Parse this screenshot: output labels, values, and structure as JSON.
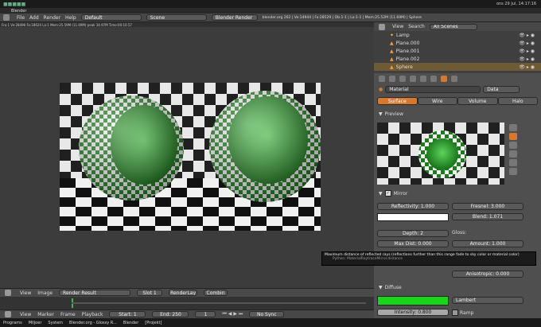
{
  "system_top": {
    "tray_text": "ons 29 Jul, 14:17:16"
  },
  "window_title": "Blender",
  "infobar": {
    "menus": [
      "File",
      "Add",
      "Render",
      "Help"
    ],
    "layout": "Default",
    "scene": "Scene",
    "engine": "Blender Render",
    "stats": "blender.org 262 | Ve:14944 | Fa:28529 | Ob:1-1 | La:1-1 | Mem:25.52M (11.69M) | Sphere"
  },
  "render_stats": "Fra:1  Ve:28496 Fa:18624 La:1 Mem:25.59M (11.69M) peak 34.97M Time:00:10.57",
  "outliner": {
    "view": "View",
    "search": "Search",
    "filter": "All Scenes",
    "items": [
      "Lamp",
      "Plane.000",
      "Plane.001",
      "Plane.002",
      "Sphere"
    ]
  },
  "properties": {
    "material_name": "Material",
    "data_label": "Data",
    "tabs": [
      "Surface",
      "Wire",
      "Volume",
      "Halo"
    ],
    "preview_label": "Preview",
    "mirror_label": "Mirror",
    "reflectivity": "Reflectivity: 1.000",
    "fresnel": "Fresnel: 3.000",
    "blend": "Blend: 1.071",
    "depth": "Depth: 2",
    "gloss_label": "Gloss:",
    "max_dist": "Max Dist: 0.000",
    "amount": "Amount: 1.000",
    "anisotropic": "Anisotropic: 0.000",
    "diffuse_label": "Diffuse",
    "shader": "Lambert",
    "intensity": "Intensity: 0.800",
    "ramp": "Ramp"
  },
  "tooltip": {
    "text": "Maximum distance of reflected rays (reflections further than this range fade to sky color or material color)",
    "python": "Python: MaterialRaytraceMirror.distance"
  },
  "image_editor": {
    "menus": [
      "View",
      "Image"
    ],
    "image_name": "Render Result",
    "slot": "Slot 1",
    "layer": "RenderLay",
    "pass": "Combin"
  },
  "timeline": {
    "menus": [
      "View",
      "Marker",
      "Frame",
      "Playback"
    ],
    "start": "Start: 1",
    "end": "End: 250",
    "current": "1",
    "sync": "No Sync"
  },
  "taskbar": {
    "items": [
      "Programs",
      "Miljoer",
      "System",
      "Blender.org - Glossy R...",
      "Blender",
      "[Projekt]"
    ]
  },
  "colors": {
    "accent": "#d8782a",
    "diffuse": "#1ad61a",
    "checker_green": "#1f7a1f"
  }
}
